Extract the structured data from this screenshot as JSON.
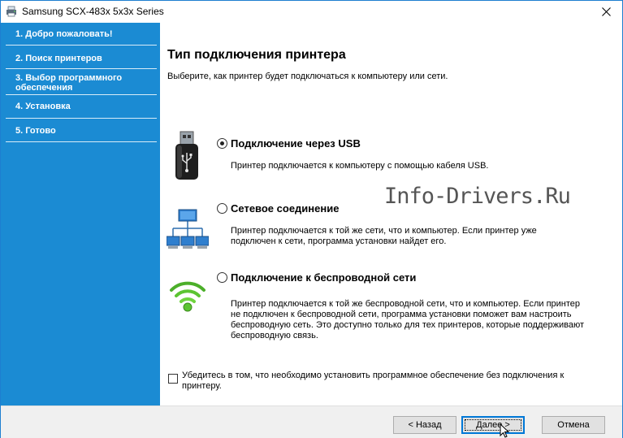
{
  "window": {
    "title": "Samsung SCX-483x 5x3x Series"
  },
  "sidebar": {
    "steps": [
      {
        "label": "1. Добро пожаловать!"
      },
      {
        "label": "2. Поиск принтеров"
      },
      {
        "label": "3. Выбор программного обеспечения"
      },
      {
        "label": "4. Установка"
      },
      {
        "label": "5. Готово"
      }
    ]
  },
  "main": {
    "title": "Тип подключения принтера",
    "subtitle": "Выберите, как принтер будет подключаться к компьютеру или сети."
  },
  "options": [
    {
      "label": "Подключение через USB",
      "description": "Принтер подключается к компьютеру с помощью кабеля USB.",
      "selected": true,
      "icon": "usb-drive-icon"
    },
    {
      "label": "Сетевое соединение",
      "description": "Принтер подключается к той же сети, что и компьютер. Если принтер уже подключен к сети, программа установки найдет его.",
      "selected": false,
      "icon": "network-icon"
    },
    {
      "label": "Подключение к беспроводной сети",
      "description": "Принтер подключается к той же беспроводной сети, что и компьютер. Если принтер не подключен к беспроводной сети, программа установки поможет вам настроить беспроводную сеть. Это доступно только для тех принтеров, которые поддерживают беспроводную связь.",
      "selected": false,
      "icon": "wifi-icon"
    }
  ],
  "watermark": "Info-Drivers.Ru",
  "install_without_connection": {
    "label": "Убедитесь в том, что необходимо установить программное обеспечение без подключения к принтеру.",
    "checked": false
  },
  "buttons": {
    "back": "< Назад",
    "next": "Далее >",
    "cancel": "Отмена"
  },
  "colors": {
    "sidebar": "#1b8bd3",
    "accent": "#0078d7",
    "footer": "#f0f0f0"
  }
}
